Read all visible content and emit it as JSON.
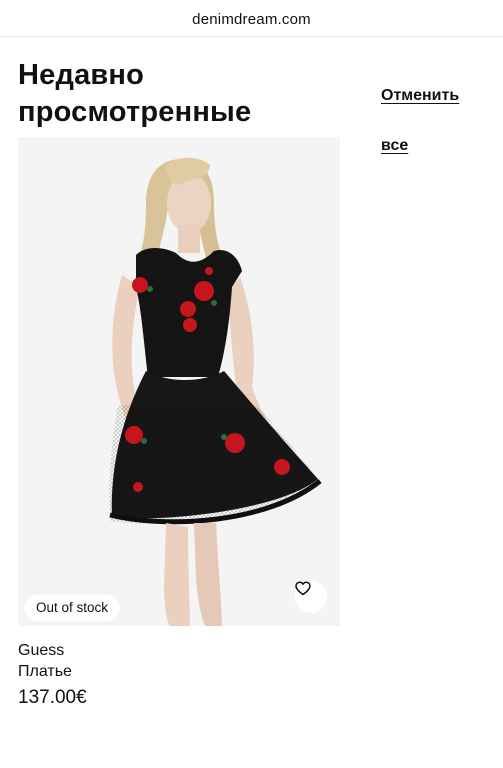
{
  "browser": {
    "url": "denimdream.com"
  },
  "page": {
    "title": "Недавно просмотренные",
    "cancel_all_label": "Отменить все"
  },
  "product": {
    "image_alt": "Black mesh dress with red rose embroidery",
    "stock_badge": "Out of stock",
    "brand": "Guess",
    "name": "Платье",
    "price": "137.00€",
    "wishlist_icon": "heart-icon"
  },
  "colors": {
    "text": "#111111",
    "image_background": "#f3f3f3",
    "dress": "#151515",
    "roses": "#c4161c"
  }
}
